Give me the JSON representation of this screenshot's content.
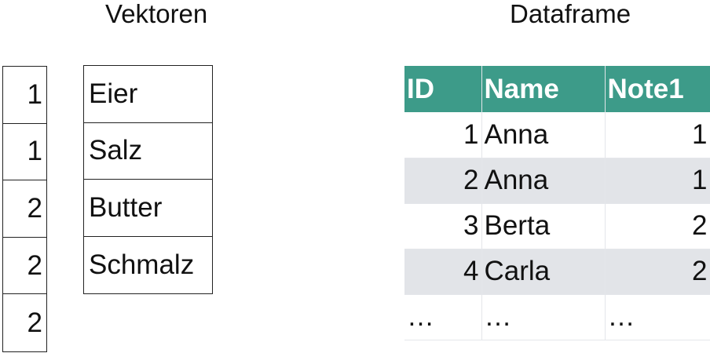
{
  "headings": {
    "vectors": "Vektoren",
    "dataframe": "Dataframe"
  },
  "numeric_vector": [
    "1",
    "1",
    "2",
    "2",
    "2"
  ],
  "character_vector": [
    "Eier",
    "Salz",
    "Butter",
    "Schmalz"
  ],
  "dataframe": {
    "columns": [
      "ID",
      "Name",
      "Note1"
    ],
    "rows": [
      [
        "1",
        "Anna",
        "1"
      ],
      [
        "2",
        "Anna",
        "1"
      ],
      [
        "3",
        "Berta",
        "2"
      ],
      [
        "4",
        "Carla",
        "2"
      ],
      [
        "…",
        "…",
        "…"
      ]
    ]
  },
  "colors": {
    "header_background": "#3d9b89",
    "stripe_background": "#e2e4e8",
    "grid_lines": "#e4e6ea"
  }
}
